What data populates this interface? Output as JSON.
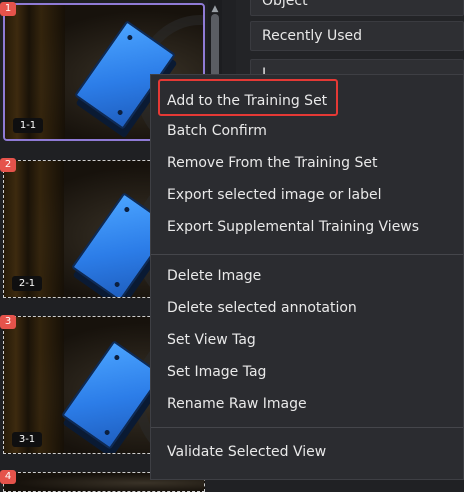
{
  "thumbnails": [
    {
      "index": "1",
      "label": "1-1",
      "selected": true
    },
    {
      "index": "2",
      "label": "2-1",
      "selected": false
    },
    {
      "index": "3",
      "label": "3-1",
      "selected": false
    },
    {
      "index": "4",
      "label": "",
      "selected": false
    }
  ],
  "panel": {
    "top_item": "Object",
    "sort_option": "Recently Used",
    "third_item": "L..."
  },
  "context_menu": {
    "group1": [
      "Add to the Training Set",
      "Batch Confirm",
      "Remove From the Training Set",
      "Export selected image or label",
      "Export Supplemental Training Views"
    ],
    "group2": [
      "Delete Image",
      "Delete selected annotation",
      "Set View Tag",
      "Set Image Tag",
      "Rename Raw Image"
    ],
    "group3": [
      "Validate Selected View"
    ],
    "highlighted_item": "Add to the Training Set"
  },
  "colors": {
    "highlight_border": "#e53935",
    "selected_border": "#8f7bd6",
    "badge": "#e5534b"
  },
  "icons": {
    "scroll_up": "chevron-up-icon"
  }
}
